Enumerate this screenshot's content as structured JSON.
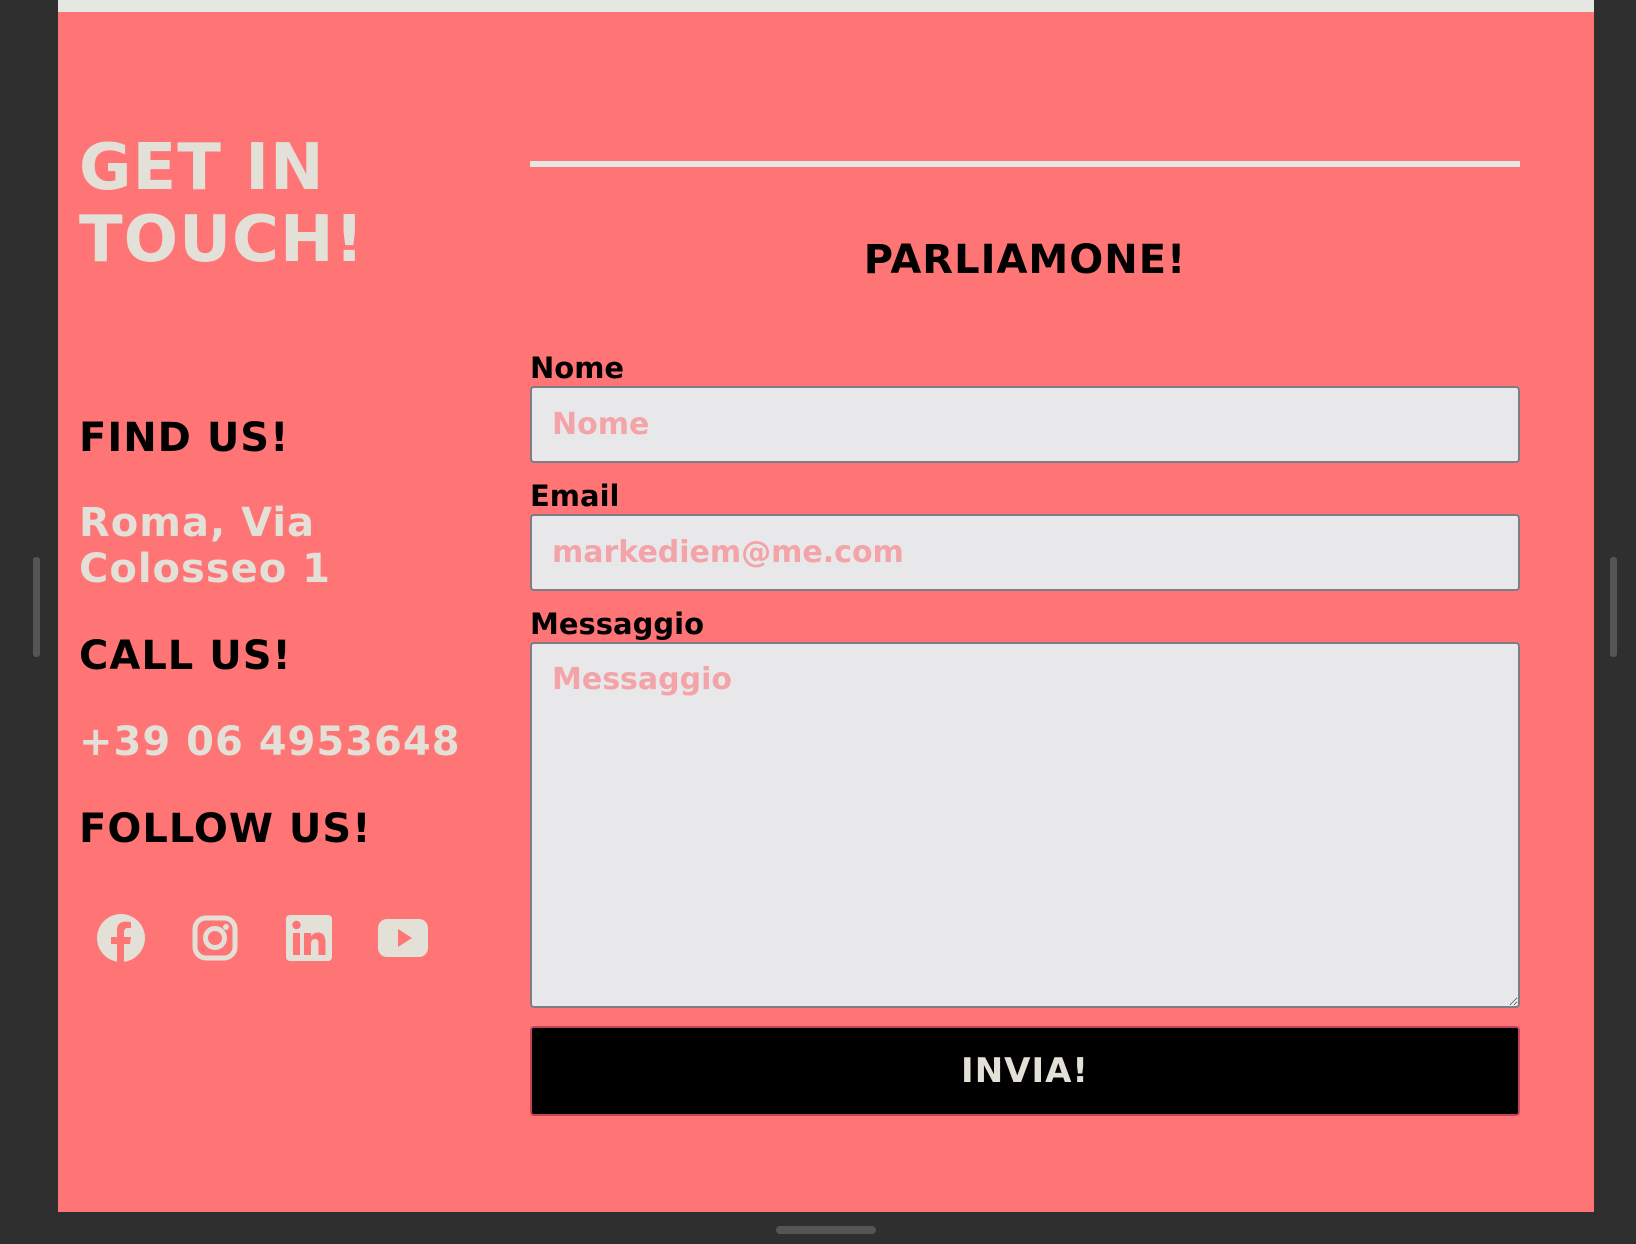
{
  "contact": {
    "title_line1": "GET IN",
    "title_line2": "TOUCH!",
    "find_heading": "FIND US!",
    "address_line1": "Roma, Via",
    "address_line2": "Colosseo 1",
    "call_heading": "CALL US!",
    "phone": "+39 06 4953648",
    "follow_heading": "FOLLOW US!",
    "social_icons": [
      "facebook-icon",
      "instagram-icon",
      "linkedin-icon",
      "youtube-icon"
    ]
  },
  "form": {
    "title": "PARLIAMONE!",
    "name_label": "Nome",
    "name_placeholder": "Nome",
    "email_label": "Email",
    "email_placeholder": "markediem@me.com",
    "message_label": "Messaggio",
    "message_placeholder": "Messaggio",
    "submit_label": "INVIA!"
  },
  "colors": {
    "background": "#ff7474",
    "accent_text": "#e3e0d8",
    "heading_text": "#000000",
    "input_background": "#e8e8ea",
    "placeholder": "#f3a4a8",
    "button_background": "#000000"
  }
}
